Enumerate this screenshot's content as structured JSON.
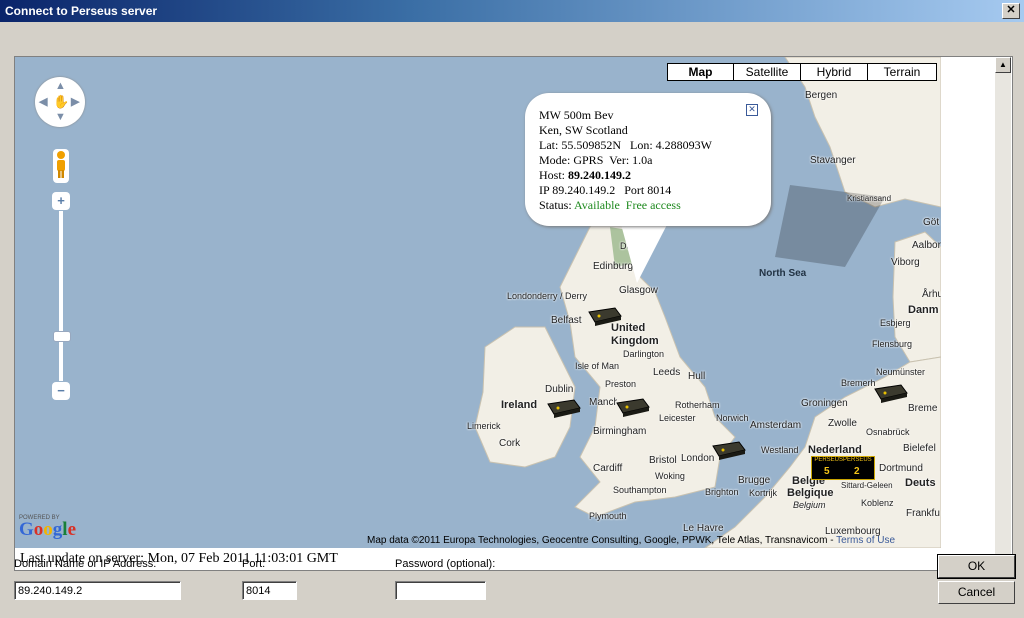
{
  "window": {
    "title": "Connect to Perseus server",
    "close_glyph": "✕"
  },
  "map": {
    "type_buttons": [
      "Map",
      "Satellite",
      "Hybrid",
      "Terrain"
    ],
    "active_type": "Map",
    "zoom_plus": "+",
    "zoom_minus": "−",
    "pan_arrows": {
      "up": "▲",
      "down": "▼",
      "left": "◀",
      "right": "▶",
      "center": "✋"
    },
    "water_color": "#99b3cc",
    "land_color": "#f2efe6",
    "balloon": {
      "line1": "MW 500m Bev",
      "line2": "Ken, SW Scotland",
      "lat_label": "Lat:",
      "lat": "55.509852N",
      "lon_label": "Lon:",
      "lon": "4.288093W",
      "mode_label": "Mode:",
      "mode": "GPRS",
      "ver_label": "Ver:",
      "ver": "1.0a",
      "host_label": "Host:",
      "host": "89.240.149.2",
      "ip_label": "IP",
      "ip": "89.240.149.2",
      "port_label": "Port",
      "port": "8014",
      "status_label": "Status:",
      "status": "Available",
      "access": "Free access",
      "close_glyph": "✕"
    },
    "places": [
      {
        "name": "Bergen"
      },
      {
        "name": "Stavanger"
      },
      {
        "name": "Kristiansand"
      },
      {
        "name": "Göt"
      },
      {
        "name": "Aalbor"
      },
      {
        "name": "Viborg"
      },
      {
        "name": "Århu"
      },
      {
        "name": "Danm"
      },
      {
        "name": "Esbjerg"
      },
      {
        "name": "Flensburg"
      },
      {
        "name": "Neumünster"
      },
      {
        "name": "Bremerh"
      },
      {
        "name": "Breme"
      },
      {
        "name": "Groningen"
      },
      {
        "name": "Zwolle"
      },
      {
        "name": "Osnabrück"
      },
      {
        "name": "Bielefel"
      },
      {
        "name": "Amsterdam"
      },
      {
        "name": "Nederland"
      },
      {
        "name": "Westland"
      },
      {
        "name": "Dortmund"
      },
      {
        "name": "Deuts"
      },
      {
        "name": "Brugge"
      },
      {
        "name": "Kortrijk"
      },
      {
        "name": "België"
      },
      {
        "name": "Belgique"
      },
      {
        "name": "Belgium"
      },
      {
        "name": "Sittard-Geleen"
      },
      {
        "name": "Koblenz"
      },
      {
        "name": "Frankfu"
      },
      {
        "name": "Luxembourg"
      },
      {
        "name": "Le Havre"
      },
      {
        "name": "Edinburgh"
      },
      {
        "name": "Dundee"
      },
      {
        "name": "Glasgow"
      },
      {
        "name": "Londonderry / Derry"
      },
      {
        "name": "Belfast"
      },
      {
        "name": "United Kingdom"
      },
      {
        "name": "Darlington"
      },
      {
        "name": "Isle of Man"
      },
      {
        "name": "Leeds"
      },
      {
        "name": "Hull"
      },
      {
        "name": "Preston"
      },
      {
        "name": "Dublin"
      },
      {
        "name": "Ireland"
      },
      {
        "name": "Manchester"
      },
      {
        "name": "Rotherham"
      },
      {
        "name": "Limerick"
      },
      {
        "name": "Norwich"
      },
      {
        "name": "Birmingham"
      },
      {
        "name": "Leicester"
      },
      {
        "name": "Cork"
      },
      {
        "name": "Bristol"
      },
      {
        "name": "London"
      },
      {
        "name": "Cardiff"
      },
      {
        "name": "Woking"
      },
      {
        "name": "Southampton"
      },
      {
        "name": "Brighton"
      },
      {
        "name": "Plymouth"
      },
      {
        "name": "North Sea"
      }
    ],
    "badge": {
      "text": "PERSEUSPERSEUS",
      "num1": "5",
      "num2": "2"
    },
    "google": {
      "powered": "POWERED BY",
      "logo": "Google"
    },
    "attribution": "Map data ©2011 Europa Technologies, Geocentre Consulting, Google, PPWK, Tele Atlas, Transnavicom -",
    "terms": "Terms of Use"
  },
  "status_text": "Last update on server:  Mon, 07 Feb 2011 11:03:01 GMT",
  "scroll": {
    "up": "▲",
    "down": "▼"
  },
  "form": {
    "domain_label": "Domain Name or IP Address:",
    "domain_value": "89.240.149.2",
    "port_label": "Port:",
    "port_value": "8014",
    "password_label": "Password  (optional):",
    "password_value": ""
  },
  "buttons": {
    "ok": "OK",
    "cancel": "Cancel"
  }
}
